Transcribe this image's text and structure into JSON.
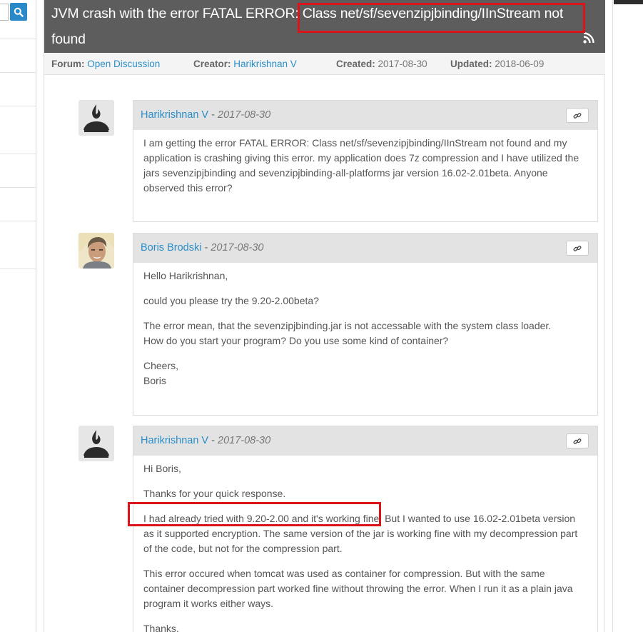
{
  "topic": {
    "title": "JVM crash with the error FATAL ERROR: Class net/sf/sevenzipjbinding/IInStream not found",
    "meta": {
      "forum_label": "Forum:",
      "forum_value": "Open Discussion",
      "creator_label": "Creator:",
      "creator_value": "Harikrishnan V",
      "created_label": "Created:",
      "created_value": "2017-08-30",
      "updated_label": "Updated:",
      "updated_value": "2018-06-09"
    }
  },
  "posts": [
    {
      "author": "Harikrishnan V",
      "separator": "-",
      "date": "2017-08-30",
      "avatar_icon": "sourceforge-default-avatar-icon",
      "lines": [
        "I am getting the error FATAL ERROR: Class net/sf/sevenzipjbinding/IInStream not found and my application is crashing giving this error. my application does 7z compression and I have utilized the jars sevenzipjbinding and sevenzipjbinding-all-platforms jar version 16.02-2.01beta. Anyone observed this error?"
      ]
    },
    {
      "author": "Boris Brodski",
      "separator": "-",
      "date": "2017-08-30",
      "avatar_icon": "user-photo-avatar",
      "lines": [
        "Hello Harikrishnan,",
        "could you please try the 9.20-2.00beta?",
        "The error mean, that the sevenzipjbinding.jar is not accessable with the system class loader.",
        "How do you start your program? Do you use some kind of container?",
        "Cheers,",
        "Boris"
      ]
    },
    {
      "author": "Harikrishnan V",
      "separator": "-",
      "date": "2017-08-30",
      "avatar_icon": "sourceforge-default-avatar-icon",
      "lines": [
        "Hi Boris,",
        "Thanks for your quick response.",
        "I had already tried with 9.20-2.00 and it's working fine. But I wanted to use 16.02-2.01beta version as it supported encryption. The same version of the jar is working fine with my decompression part of the code, but not for the compression part.",
        "This error occured when tomcat was used as container for compression. But with the same container decompression part worked fine without throwing the error. When I run it as a plain java program it works either ways.",
        "Thanks,"
      ]
    }
  ],
  "colors": {
    "header_bg": "#5d5d5d",
    "link": "#2b8ec9",
    "search_button": "#2989c9",
    "highlight": "#d9141b"
  }
}
